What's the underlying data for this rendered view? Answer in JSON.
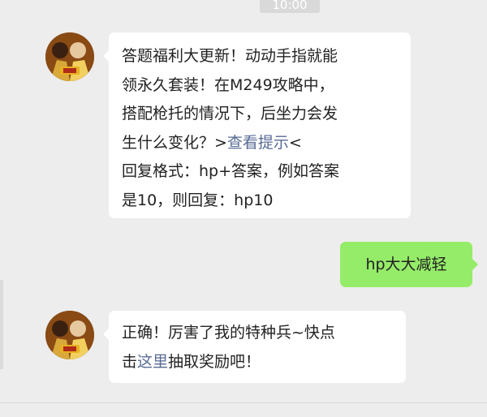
{
  "timestamp": "10:00",
  "messages": [
    {
      "direction": "incoming",
      "avatar": "game-soldier-avatar",
      "lines": [
        {
          "text": "答题福利大更新！动动手指就能"
        },
        {
          "text": "领永久套装！在M249攻略中，"
        },
        {
          "text": "搭配枪托的情况下，后坐力会发"
        },
        {
          "pre": "生什么变化？>",
          "link": "查看提示",
          "post": "<"
        },
        {
          "text": "回复格式：hp+答案，例如答案"
        },
        {
          "text": "是10，则回复：hp10"
        }
      ]
    },
    {
      "direction": "outgoing",
      "text": "hp大大减轻"
    },
    {
      "direction": "incoming",
      "avatar": "game-soldier-avatar",
      "lines": [
        {
          "text": "正确！厉害了我的特种兵~快点"
        },
        {
          "pre": "击",
          "link": "这里",
          "post": "抽取奖励吧！"
        }
      ]
    }
  ],
  "colors": {
    "background": "#ededed",
    "incoming_bubble": "#ffffff",
    "outgoing_bubble": "#95ec69",
    "link": "#576b95"
  }
}
